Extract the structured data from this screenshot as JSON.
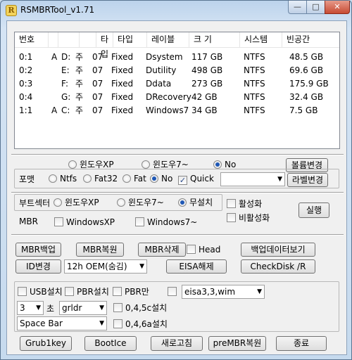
{
  "window": {
    "title": "RSMBRTool_v1.71",
    "icon_letter": "R"
  },
  "titlebar": {
    "minimize": "—",
    "maximize": "□",
    "close": "✕"
  },
  "list": {
    "headers": [
      "번호",
      "",
      "",
      "",
      "타입",
      "레이블",
      "크 기",
      "시스템",
      "빈공간"
    ],
    "rows": [
      [
        "0:1",
        "A",
        "D:",
        "주",
        "07",
        "Fixed",
        "Dsystem",
        "117 GB",
        "NTFS",
        "48.5 GB"
      ],
      [
        "0:2",
        "",
        "E:",
        "주",
        "07",
        "Fixed",
        "Dutility",
        "498 GB",
        "NTFS",
        "69.6 GB"
      ],
      [
        "0:3",
        "",
        "F:",
        "주",
        "07",
        "Fixed",
        "Ddata",
        "273 GB",
        "NTFS",
        "175.9 GB"
      ],
      [
        "0:4",
        "",
        "G:",
        "주",
        "07",
        "Fixed",
        "DRecovery",
        "42 GB",
        "NTFS",
        "32.4 GB"
      ],
      [
        "1:1",
        "A",
        "C:",
        "주",
        "07",
        "Fixed",
        "Windows7",
        "34 GB",
        "NTFS",
        "7.5 GB"
      ]
    ]
  },
  "volume": {
    "radio_xp": "윈도우XP",
    "radio_7": "윈도우7~",
    "radio_no": "No",
    "selected": "No",
    "button": "볼륨변경"
  },
  "format": {
    "label": "포맷",
    "ntfs": "Ntfs",
    "fat32": "Fat32",
    "fat": "Fat",
    "no": "No",
    "selected": "No",
    "quick": "Quick",
    "quick_checked": true,
    "combo": "",
    "button": "라벨변경"
  },
  "bootsector": {
    "label": "부트섹터",
    "xp": "윈도우XP",
    "w7": "윈도우7~",
    "none": "무설치",
    "selected": "무설치",
    "activate": "활성화",
    "deactivate": "비활성화",
    "run": "실행"
  },
  "mbr": {
    "label": "MBR",
    "xp": "WindowsXP",
    "w7": "Windows7~"
  },
  "tools": {
    "mbr_backup": "MBR백업",
    "mbr_restore": "MBR복원",
    "mbr_delete": "MBR삭제",
    "head": "Head",
    "view_backup": "백업데이터보기",
    "id_change": "ID변경",
    "oem_combo": "12h OEM(숨김)",
    "eisa": "EISA해제",
    "checkdisk": "CheckDisk /R"
  },
  "bottom": {
    "usb": "USB설치",
    "pbr_install": "PBR설치",
    "pbr_only": "PBR만",
    "eisa_combo": "eisa3,3,wim",
    "seconds_combo": "3",
    "seconds_label": "초",
    "loader_combo": "grldr",
    "v045c": "0,4,5c설치",
    "key_combo": "Space Bar",
    "v045a": "0,4,6a설치",
    "grub": "Grub1key",
    "bootice": "BootIce",
    "refresh": "새로고침",
    "premb": "preMBR복원",
    "exit": "종료"
  }
}
